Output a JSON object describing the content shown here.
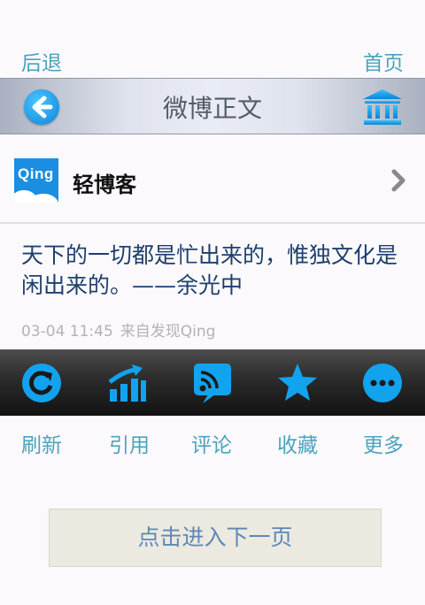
{
  "nav": {
    "back_label": "后退",
    "home_label": "首页"
  },
  "titlebar": {
    "title": "微博正文",
    "back_icon": "arrow-left-icon",
    "home_icon": "bank-icon"
  },
  "blog": {
    "logo_text": "Qing",
    "name": "轻博客",
    "chevron_icon": "chevron-right-icon"
  },
  "post": {
    "text": "天下的一切都是忙出来的，惟独文化是闲出来的。——余光中",
    "time": "03-04 11:45",
    "source": "来自发现Qing"
  },
  "toolbar": {
    "items": [
      {
        "icon": "refresh-icon",
        "label": "刷新"
      },
      {
        "icon": "quote-chart-icon",
        "label": "引用"
      },
      {
        "icon": "comment-icon",
        "label": "评论"
      },
      {
        "icon": "star-icon",
        "label": "收藏"
      },
      {
        "icon": "more-icon",
        "label": "更多"
      }
    ]
  },
  "next_page_label": "点击进入下一页",
  "colors": {
    "accent": "#4aa4bd",
    "icon_blue": "#12a3ef",
    "text_dark_blue": "#1e3f6d"
  }
}
